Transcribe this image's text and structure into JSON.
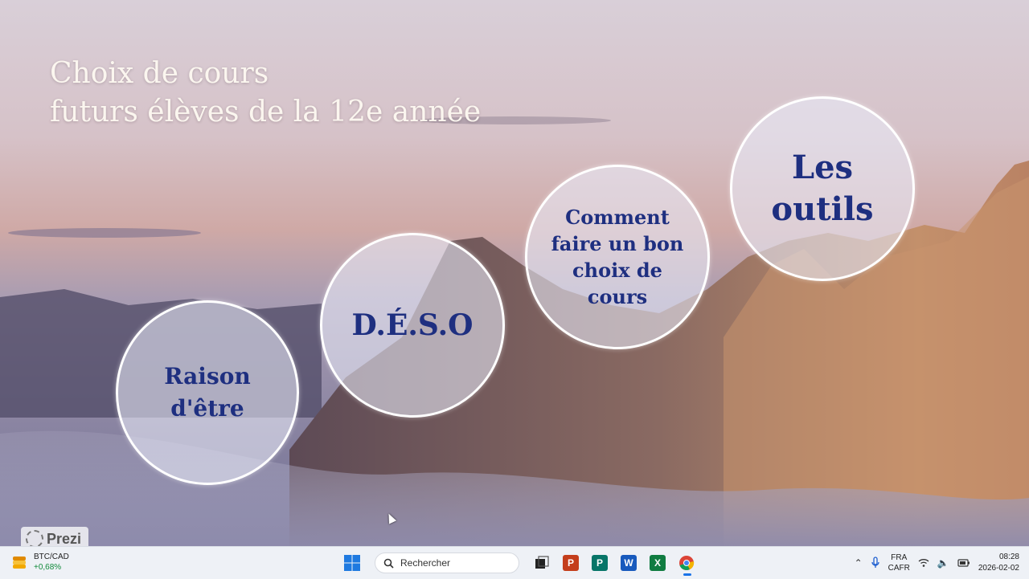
{
  "slide": {
    "title_line1": "Choix de cours",
    "title_line2": "futurs élèves de la 12e année",
    "bubbles": [
      {
        "lines": [
          "Raison",
          "d'être"
        ]
      },
      {
        "lines": [
          "D.É.S.O"
        ]
      },
      {
        "lines": [
          "Comment",
          "faire un bon",
          "choix de",
          "cours"
        ]
      },
      {
        "lines": [
          "Les",
          "outils"
        ]
      }
    ],
    "brand": "Prezi"
  },
  "taskbar": {
    "ticker_symbol": "BTC/CAD",
    "ticker_change": "+0,68%",
    "search_placeholder": "Rechercher",
    "apps": [
      "task-view",
      "powerpoint",
      "publisher",
      "word",
      "excel",
      "chrome"
    ],
    "lang_line1": "FRA",
    "lang_line2": "CAFR",
    "time": "08:28",
    "date": "2026-02-02"
  },
  "colors": {
    "bubble_text": "#1e2f80",
    "title_text": "#fbf6ef",
    "ticker_up": "#118a3b"
  }
}
